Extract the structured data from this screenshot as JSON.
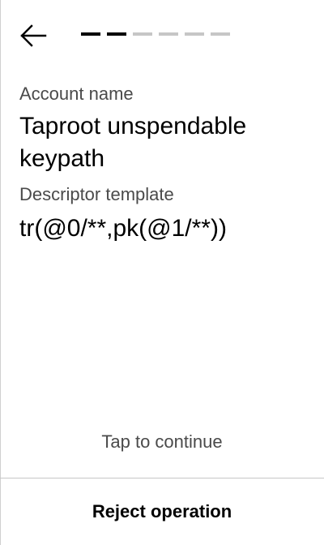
{
  "header": {
    "back_icon": "arrow-left-icon",
    "progress": {
      "total_steps": 6,
      "completed_steps": 2
    }
  },
  "fields": {
    "account_name_label": "Account name",
    "account_name_value": "Taproot unspendable keypath",
    "descriptor_label": "Descriptor template",
    "descriptor_value": "tr(@0/**,pk(@1/**))"
  },
  "footer": {
    "tap_to_continue": "Tap to continue",
    "reject_label": "Reject operation"
  },
  "colors": {
    "background": "#ffffff",
    "text_primary": "#000000",
    "text_secondary": "#4a4a4a",
    "progress_active": "#000000",
    "progress_inactive": "#c6c6c6",
    "divider": "#c6c6c6"
  }
}
